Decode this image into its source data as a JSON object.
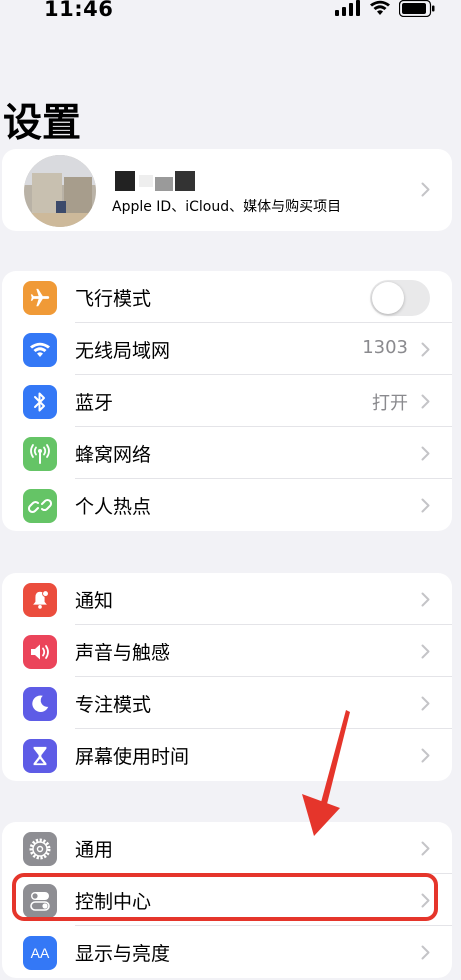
{
  "status_bar": {
    "time": "11:46"
  },
  "page": {
    "title": "设置"
  },
  "profile": {
    "subtitle": "Apple ID、iCloud、媒体与购买项目"
  },
  "group1": [
    {
      "label": "飞行模式",
      "icon": "airplane-icon",
      "color": "#f09a37",
      "toggle": "off"
    },
    {
      "label": "无线局域网",
      "value": "1303",
      "icon": "wifi-icon",
      "color": "#3478f6"
    },
    {
      "label": "蓝牙",
      "value": "打开",
      "icon": "bluetooth-icon",
      "color": "#3478f6"
    },
    {
      "label": "蜂窝网络",
      "icon": "cellular-antenna-icon",
      "color": "#65c466"
    },
    {
      "label": "个人热点",
      "icon": "personal-hotspot-icon",
      "color": "#65c466"
    }
  ],
  "group2": [
    {
      "label": "通知",
      "icon": "notification-bell-icon",
      "color": "#eb4d3d"
    },
    {
      "label": "声音与触感",
      "icon": "speaker-icon",
      "color": "#eb445a"
    },
    {
      "label": "专注模式",
      "icon": "moon-icon",
      "color": "#5e5ce6"
    },
    {
      "label": "屏幕使用时间",
      "icon": "hourglass-icon",
      "color": "#5e5ce6"
    }
  ],
  "group3": [
    {
      "label": "通用",
      "icon": "gear-icon",
      "color": "#8e8e93"
    },
    {
      "label": "控制中心",
      "icon": "control-center-icon",
      "color": "#8e8e93"
    },
    {
      "label": "显示与亮度",
      "icon": "display-brightness-icon",
      "color": "#3478f6",
      "glyph": "AA"
    }
  ],
  "annotation": {
    "color": "#e5352b",
    "target": "控制中心"
  }
}
